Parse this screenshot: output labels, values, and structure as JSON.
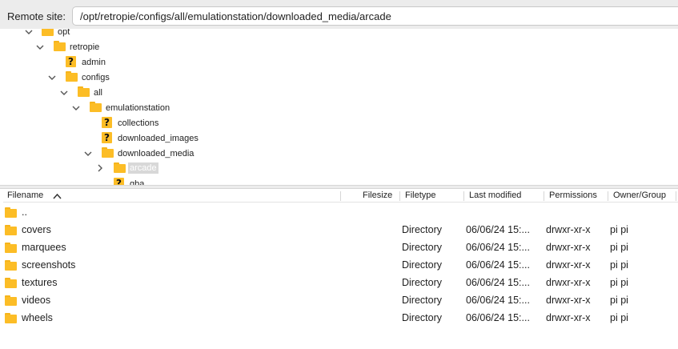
{
  "remote_site": {
    "label": "Remote site:",
    "path": "/opt/retropie/configs/all/emulationstation/downloaded_media/arcade"
  },
  "tree": [
    {
      "label": "opt",
      "icon": "folder-icon",
      "expanded": true
    },
    {
      "label": "retropie",
      "icon": "folder-icon",
      "expanded": true
    },
    {
      "label": "admin",
      "icon": "unknown-folder-icon",
      "expanded": false
    },
    {
      "label": "configs",
      "icon": "folder-icon",
      "expanded": true
    },
    {
      "label": "all",
      "icon": "folder-icon",
      "expanded": true
    },
    {
      "label": "emulationstation",
      "icon": "folder-icon",
      "expanded": true
    },
    {
      "label": "collections",
      "icon": "unknown-folder-icon",
      "expanded": false
    },
    {
      "label": "downloaded_images",
      "icon": "unknown-folder-icon",
      "expanded": false
    },
    {
      "label": "downloaded_media",
      "icon": "folder-icon",
      "expanded": true
    },
    {
      "label": "arcade",
      "icon": "folder-icon",
      "expanded": false,
      "selected": true
    },
    {
      "label": "gba",
      "icon": "unknown-folder-icon",
      "expanded": false
    }
  ],
  "columns": {
    "filename": "Filename",
    "filesize": "Filesize",
    "filetype": "Filetype",
    "modified": "Last modified",
    "permissions": "Permissions",
    "owner": "Owner/Group"
  },
  "files": [
    {
      "name": "..",
      "type": "",
      "modified": "",
      "permissions": "",
      "owner": ""
    },
    {
      "name": "covers",
      "type": "Directory",
      "modified": "06/06/24 15:...",
      "permissions": "drwxr-xr-x",
      "owner": "pi pi"
    },
    {
      "name": "marquees",
      "type": "Directory",
      "modified": "06/06/24 15:...",
      "permissions": "drwxr-xr-x",
      "owner": "pi pi"
    },
    {
      "name": "screenshots",
      "type": "Directory",
      "modified": "06/06/24 15:...",
      "permissions": "drwxr-xr-x",
      "owner": "pi pi"
    },
    {
      "name": "textures",
      "type": "Directory",
      "modified": "06/06/24 15:...",
      "permissions": "drwxr-xr-x",
      "owner": "pi pi"
    },
    {
      "name": "videos",
      "type": "Directory",
      "modified": "06/06/24 15:...",
      "permissions": "drwxr-xr-x",
      "owner": "pi pi"
    },
    {
      "name": "wheels",
      "type": "Directory",
      "modified": "06/06/24 15:...",
      "permissions": "drwxr-xr-x",
      "owner": "pi pi"
    }
  ],
  "colors": {
    "folder": "#fcbd26",
    "selection": "#d8d8d8",
    "toolbar": "#ececec"
  }
}
